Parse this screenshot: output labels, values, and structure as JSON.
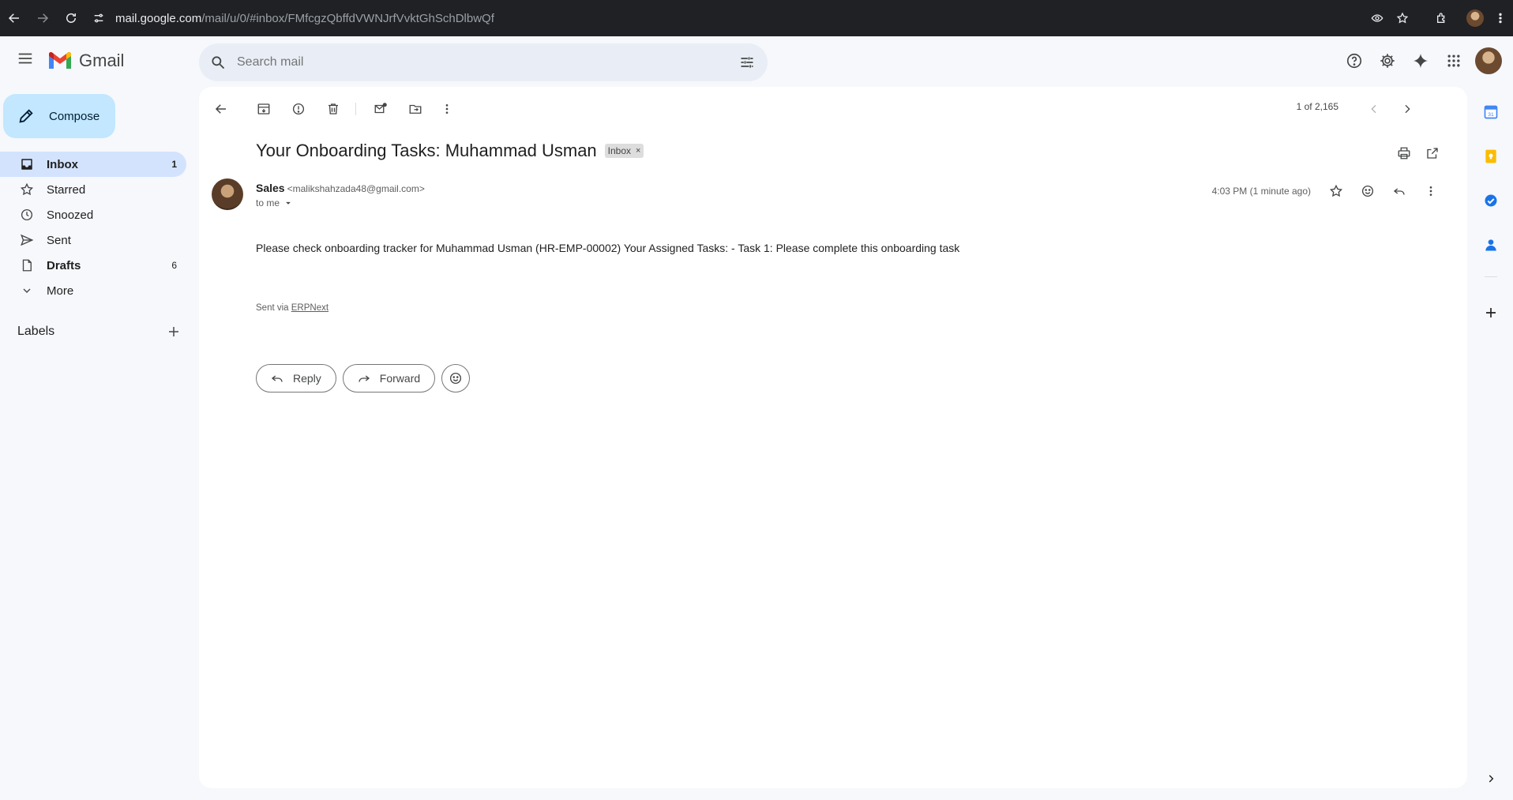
{
  "browser": {
    "url_host": "mail.google.com",
    "url_path": "/mail/u/0/#inbox/FMfcgzQbffdVWNJrfVvktGhSchDlbwQf"
  },
  "header": {
    "logo_text": "Gmail",
    "search_placeholder": "Search mail"
  },
  "sidebar": {
    "compose_label": "Compose",
    "items": [
      {
        "label": "Inbox",
        "count": "1",
        "icon": "inbox-icon"
      },
      {
        "label": "Starred",
        "count": "",
        "icon": "star-icon"
      },
      {
        "label": "Snoozed",
        "count": "",
        "icon": "clock-icon"
      },
      {
        "label": "Sent",
        "count": "",
        "icon": "send-icon"
      },
      {
        "label": "Drafts",
        "count": "6",
        "icon": "draft-icon"
      },
      {
        "label": "More",
        "count": "",
        "icon": "chevron-down-icon"
      }
    ],
    "labels_title": "Labels"
  },
  "toolbar": {
    "pager": "1 of 2,165"
  },
  "email": {
    "subject": "Your Onboarding Tasks: Muhammad Usman",
    "chip": "Inbox",
    "chip_close": "×",
    "from_name": "Sales",
    "from_email": "<malikshahzada48@gmail.com>",
    "to": "to me",
    "time": "4:03 PM (1 minute ago)",
    "body": "Please check onboarding tracker for Muhammad Usman (HR-EMP-00002) Your Assigned Tasks: - Task 1: Please complete this onboarding task",
    "sent_via_prefix": "Sent via ",
    "sent_via_link": "ERPNext"
  },
  "actions": {
    "reply": "Reply",
    "forward": "Forward"
  },
  "colors": {
    "compose_bg": "#c2e7ff",
    "active_nav_bg": "#d3e3fd",
    "app_bg": "#f6f8fc"
  }
}
